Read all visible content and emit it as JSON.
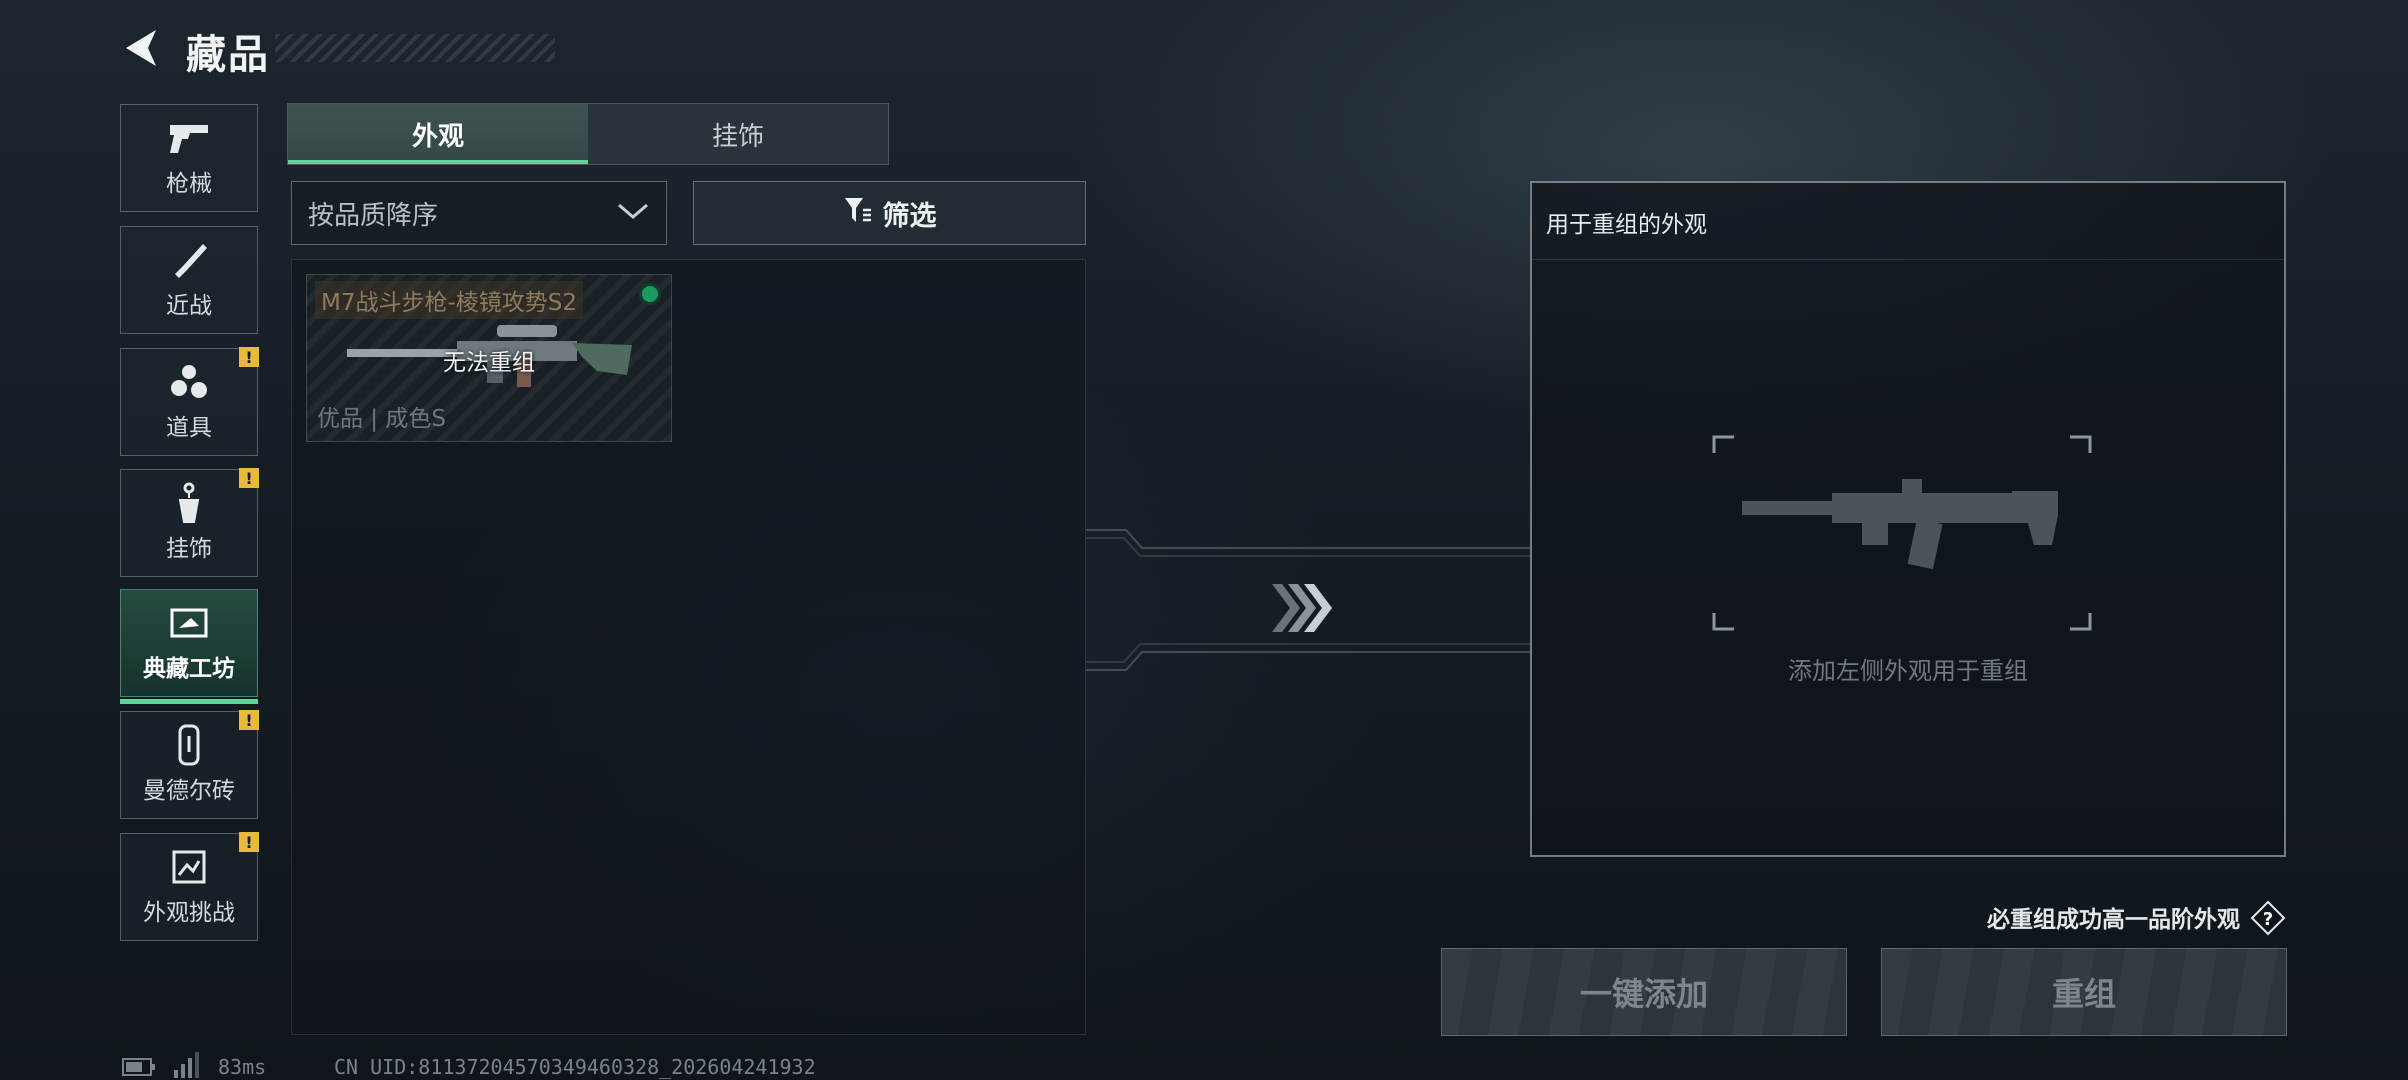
{
  "header": {
    "title": "藏品"
  },
  "sidebar": {
    "items": [
      {
        "label": "枪械",
        "icon": "pistol-icon",
        "badge": ""
      },
      {
        "label": "近战",
        "icon": "knife-icon",
        "badge": ""
      },
      {
        "label": "道具",
        "icon": "grenades-icon",
        "badge": "!"
      },
      {
        "label": "挂饰",
        "icon": "charm-icon",
        "badge": "!"
      },
      {
        "label": "典藏工坊",
        "icon": "workshop-icon",
        "badge": "",
        "active": true
      },
      {
        "label": "曼德尔砖",
        "icon": "brick-icon",
        "badge": "!"
      },
      {
        "label": "外观挑战",
        "icon": "challenge-icon",
        "badge": "!"
      }
    ]
  },
  "tabs": [
    {
      "label": "外观",
      "active": true
    },
    {
      "label": "挂饰",
      "active": false
    }
  ],
  "sort": {
    "value": "按品质降序"
  },
  "filter": {
    "label": "筛选"
  },
  "list": {
    "items": [
      {
        "name": "M7战斗步枪-棱镜攻势S2",
        "status": "无法重组",
        "meta": "优品 | 成色S"
      }
    ]
  },
  "recombine": {
    "title": "用于重组的外观",
    "hint": "添加左侧外观用于重组",
    "guarantee": "必重组成功高一品阶外观",
    "help": "?"
  },
  "actions": {
    "add_all": "一键添加",
    "recombine": "重组"
  },
  "footer": {
    "ping": "83ms",
    "uid": "CN UID:81137204570349460328_202604241932"
  },
  "colors": {
    "accent": "#5fd39a",
    "badge": "#e8b93a",
    "quality_dot": "#1e9960"
  }
}
